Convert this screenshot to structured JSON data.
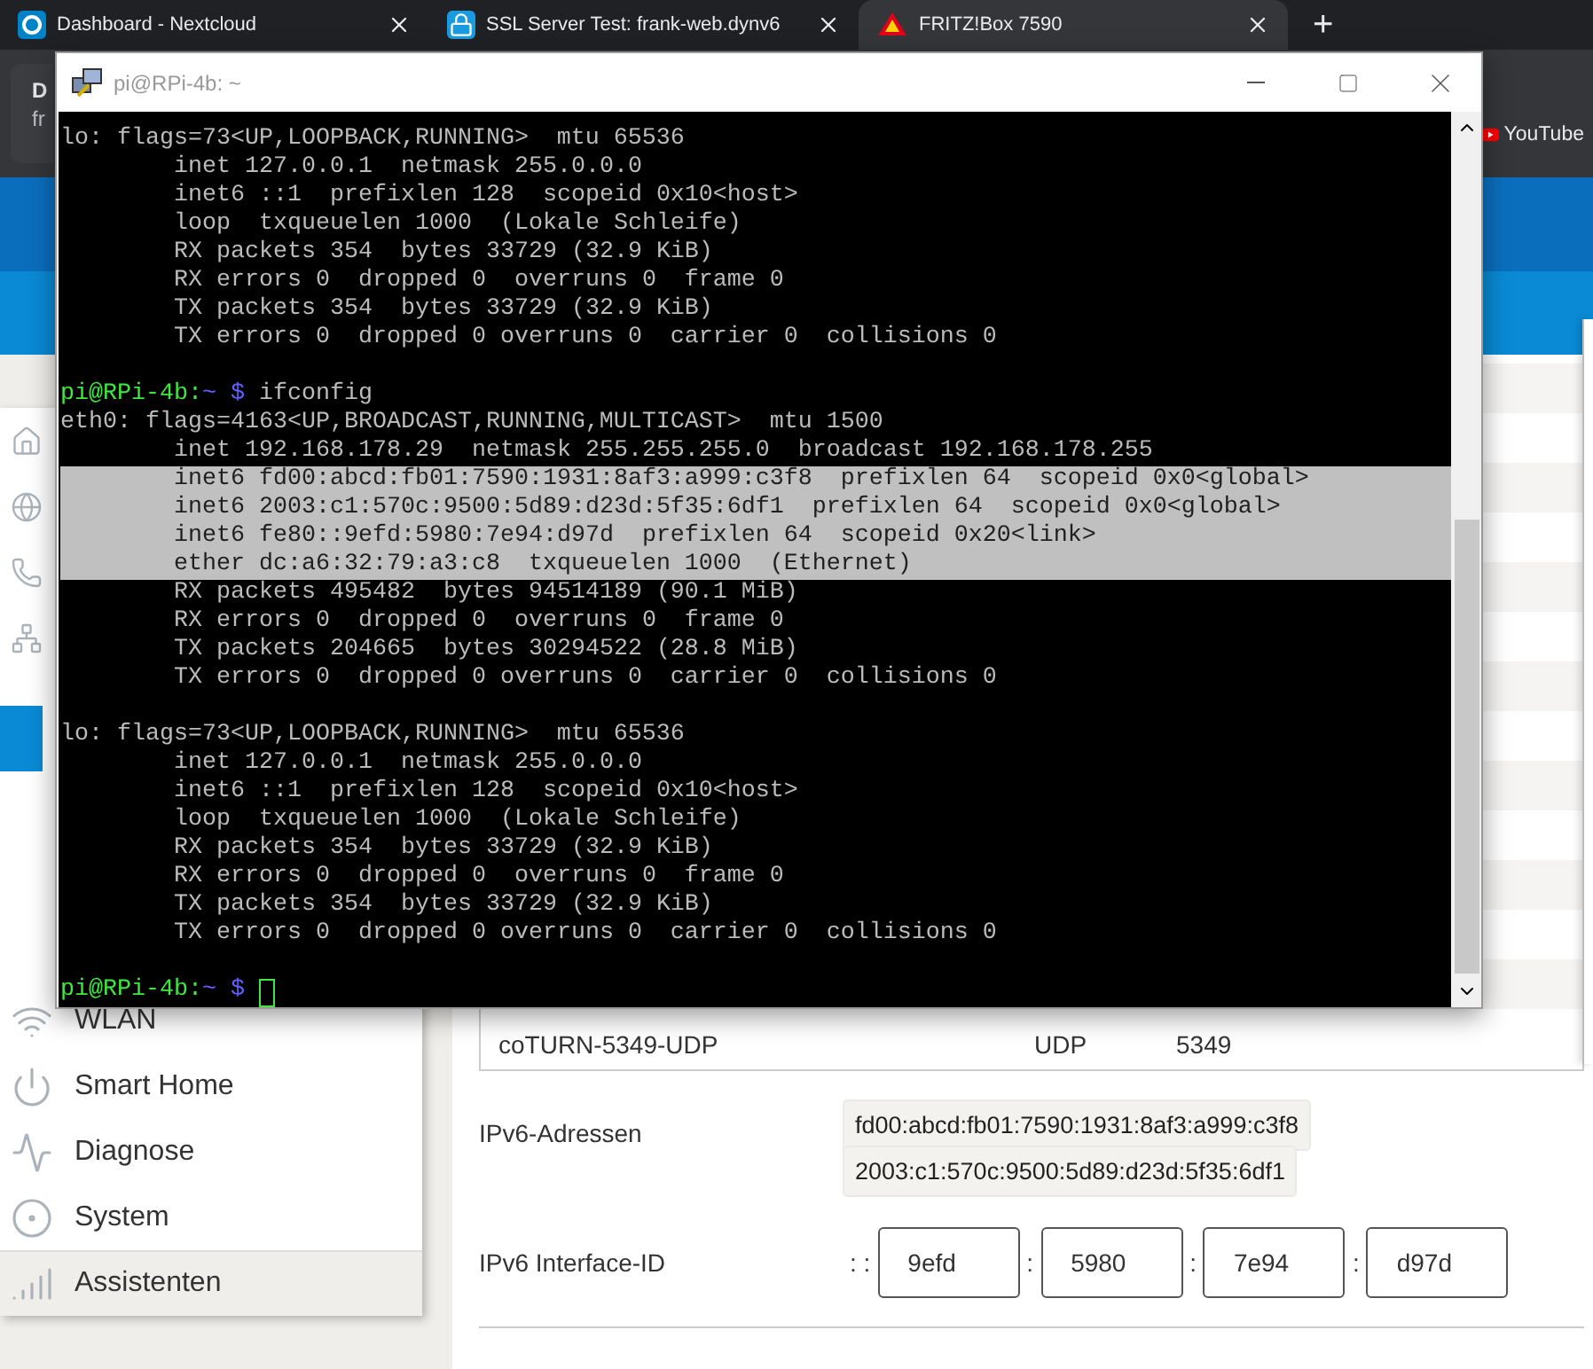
{
  "browser": {
    "tabs": [
      {
        "title": "Dashboard - Nextcloud",
        "selected": false
      },
      {
        "title": "SSL Server Test: frank-web.dynv6",
        "selected": false
      },
      {
        "title": "FRITZ!Box 7590",
        "selected": true
      }
    ],
    "new_tab": "+",
    "hover_card": {
      "title": "D",
      "url": "fr"
    },
    "bookmarks": [
      "YouTube"
    ]
  },
  "sidebar": {
    "items": [
      {
        "selected": false
      },
      {
        "selected": false
      },
      {
        "selected": false
      },
      {
        "selected": false
      },
      {
        "selected": true
      },
      {
        "label": "WLAN",
        "selected": false
      },
      {
        "label": "Smart Home",
        "selected": false
      },
      {
        "label": "Diagnose",
        "selected": false
      },
      {
        "label": "System",
        "selected": false
      },
      {
        "label": "Assistenten",
        "selected": false,
        "hovered": true
      }
    ]
  },
  "content": {
    "port_row": {
      "name": "coTURN-5349-UDP",
      "protocol": "UDP",
      "port": "5349"
    },
    "ipv6_addresses": {
      "label": "IPv6-Adressen",
      "values": [
        "fd00:abcd:fb01:7590:1931:8af3:a999:c3f8",
        "2003:c1:570c:9500:5d89:d23d:5f35:6df1"
      ]
    },
    "interface_id": {
      "label": "IPv6 Interface-ID",
      "prefix": ": :",
      "fields": [
        {
          "value": "9efd"
        },
        {
          "separator": ":",
          "value": "5980"
        },
        {
          "separator": ":",
          "value": "7e94"
        },
        {
          "separator": ":",
          "value": "d97d"
        }
      ]
    }
  },
  "terminal": {
    "title": "pi@RPi-4b: ~",
    "lines": [
      {
        "kind": "output",
        "indented": false,
        "selected": false,
        "text": "lo: flags=73<UP,LOOPBACK,RUNNING>  mtu 65536"
      },
      {
        "kind": "output",
        "indented": true,
        "selected": false,
        "text": "inet 127.0.0.1  netmask 255.0.0.0"
      },
      {
        "kind": "output",
        "indented": true,
        "selected": false,
        "text": "inet6 ::1  prefixlen 128  scopeid 0x10<host>"
      },
      {
        "kind": "output",
        "indented": true,
        "selected": false,
        "text": "loop  txqueuelen 1000  (Lokale Schleife)"
      },
      {
        "kind": "output",
        "indented": true,
        "selected": false,
        "text": "RX packets 354  bytes 33729 (32.9 KiB)"
      },
      {
        "kind": "output",
        "indented": true,
        "selected": false,
        "text": "RX errors 0  dropped 0  overruns 0  frame 0"
      },
      {
        "kind": "output",
        "indented": true,
        "selected": false,
        "text": "TX packets 354  bytes 33729 (32.9 KiB)"
      },
      {
        "kind": "output",
        "indented": true,
        "selected": false,
        "text": "TX errors 0  dropped 0 overruns 0  carrier 0  collisions 0"
      },
      {
        "kind": "blank"
      },
      {
        "kind": "prompt",
        "host": "pi@RPi-4b:",
        "dir": "~",
        "symbol": "$",
        "command": "ifconfig",
        "cursor": false
      },
      {
        "kind": "output",
        "indented": false,
        "selected": false,
        "text": "eth0: flags=4163<UP,BROADCAST,RUNNING,MULTICAST>  mtu 1500"
      },
      {
        "kind": "output",
        "indented": true,
        "selected": false,
        "text": "inet 192.168.178.29  netmask 255.255.255.0  broadcast 192.168.178.255"
      },
      {
        "kind": "output",
        "indented": true,
        "selected": true,
        "text": "inet6 fd00:abcd:fb01:7590:1931:8af3:a999:c3f8  prefixlen 64  scopeid 0x0<global>"
      },
      {
        "kind": "output",
        "indented": true,
        "selected": true,
        "text": "inet6 2003:c1:570c:9500:5d89:d23d:5f35:6df1  prefixlen 64  scopeid 0x0<global>"
      },
      {
        "kind": "output",
        "indented": true,
        "selected": true,
        "text": "inet6 fe80::9efd:5980:7e94:d97d  prefixlen 64  scopeid 0x20<link>"
      },
      {
        "kind": "output",
        "indented": true,
        "selected": true,
        "text": "ether dc:a6:32:79:a3:c8  txqueuelen 1000  (Ethernet)"
      },
      {
        "kind": "output",
        "indented": true,
        "selected": false,
        "text": "RX packets 495482  bytes 94514189 (90.1 MiB)"
      },
      {
        "kind": "output",
        "indented": true,
        "selected": false,
        "text": "RX errors 0  dropped 0  overruns 0  frame 0"
      },
      {
        "kind": "output",
        "indented": true,
        "selected": false,
        "text": "TX packets 204665  bytes 30294522 (28.8 MiB)"
      },
      {
        "kind": "output",
        "indented": true,
        "selected": false,
        "text": "TX errors 0  dropped 0 overruns 0  carrier 0  collisions 0"
      },
      {
        "kind": "blank"
      },
      {
        "kind": "output",
        "indented": false,
        "selected": false,
        "text": "lo: flags=73<UP,LOOPBACK,RUNNING>  mtu 65536"
      },
      {
        "kind": "output",
        "indented": true,
        "selected": false,
        "text": "inet 127.0.0.1  netmask 255.0.0.0"
      },
      {
        "kind": "output",
        "indented": true,
        "selected": false,
        "text": "inet6 ::1  prefixlen 128  scopeid 0x10<host>"
      },
      {
        "kind": "output",
        "indented": true,
        "selected": false,
        "text": "loop  txqueuelen 1000  (Lokale Schleife)"
      },
      {
        "kind": "output",
        "indented": true,
        "selected": false,
        "text": "RX packets 354  bytes 33729 (32.9 KiB)"
      },
      {
        "kind": "output",
        "indented": true,
        "selected": false,
        "text": "RX errors 0  dropped 0  overruns 0  frame 0"
      },
      {
        "kind": "output",
        "indented": true,
        "selected": false,
        "text": "TX packets 354  bytes 33729 (32.9 KiB)"
      },
      {
        "kind": "output",
        "indented": true,
        "selected": false,
        "text": "TX errors 0  dropped 0 overruns 0  carrier 0  collisions 0"
      },
      {
        "kind": "blank"
      },
      {
        "kind": "prompt",
        "host": "pi@RPi-4b:",
        "dir": "~",
        "symbol": "$",
        "cursor": true
      }
    ]
  }
}
